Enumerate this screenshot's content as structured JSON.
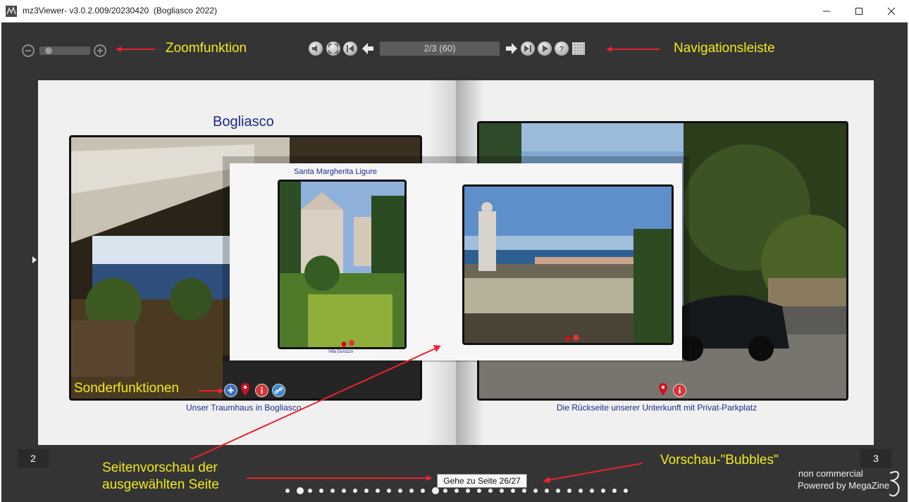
{
  "window": {
    "title": "mz3Viewer- v3.0.2.009/20230420  (Bogliasco 2022)"
  },
  "toolbar": {
    "page_indicator": "2/3 (60)",
    "zoom_level": 0.1
  },
  "annotations": {
    "zoom": "Zoomfunktion",
    "navigation": "Navigationsleiste",
    "special": "Sonderfunktionen",
    "preview_page": "Seitenvorschau der ausgewählten Seite",
    "preview_page_line1": "Seitenvorschau der",
    "preview_page_line2": "ausgewählten Seite",
    "bubbles": "Vorschau-\"Bubbles\""
  },
  "left_page": {
    "title": "Bogliasco",
    "caption": "Unser Traumhaus in Bogliasco",
    "number": "2"
  },
  "right_page": {
    "caption": "Die Rückseite unserer Unterkunft mit Privat-Parkplatz",
    "number": "3"
  },
  "preview": {
    "title": "Santa Margherita Ligure",
    "small_caption": "Villa Durazzo"
  },
  "footer": {
    "goto_tooltip": "Gehe zu Seite 26/27",
    "bubble_count": 31,
    "active_bubble": 13,
    "brand_line1": "non commercial",
    "brand_line2": "Powered by MegaZine"
  },
  "colors": {
    "annotation": "#f2ea1a",
    "arrow": "#e8232e",
    "caption": "#1c2a8a",
    "viewer_bg": "#343434"
  }
}
